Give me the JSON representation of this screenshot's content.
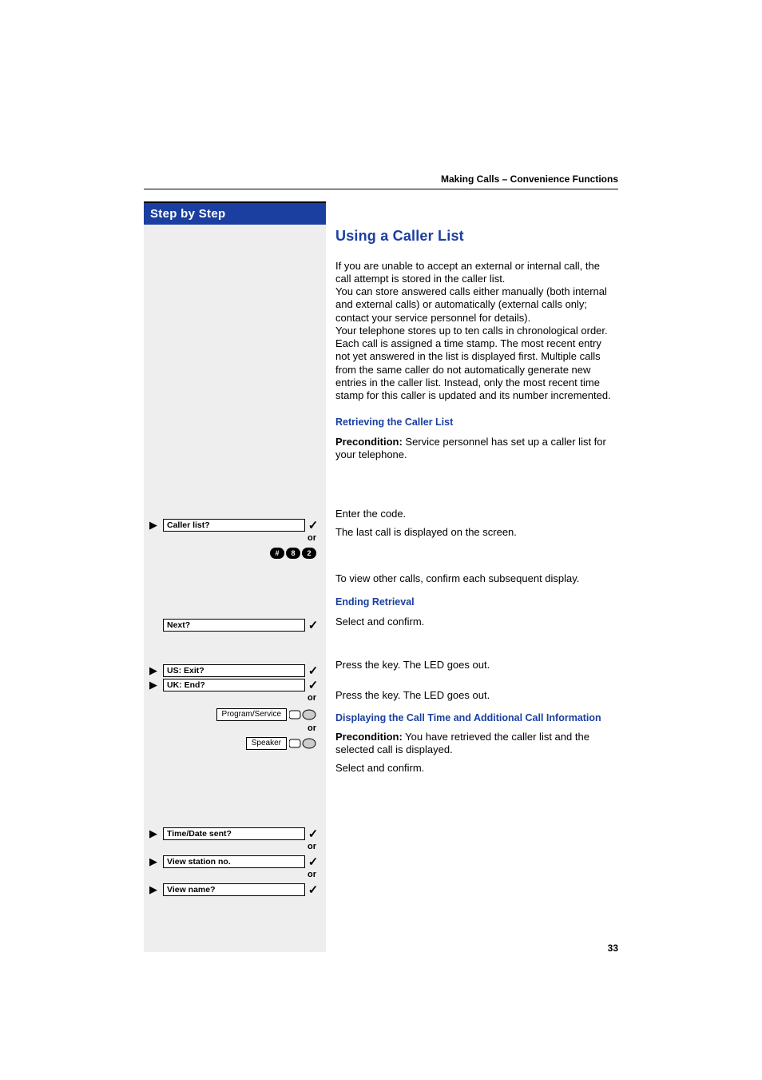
{
  "header": "Making Calls – Convenience Functions",
  "step_header": "Step by Step",
  "page_number": "33",
  "section_title": "Using a Caller List",
  "intro": "If you are unable to accept an external or internal call, the call attempt is stored in the caller list.\nYou can store answered calls either manually (both internal and external calls) or automatically (external calls only; contact your service personnel for details).\nYour telephone stores up to ten calls in chronological order. Each call is assigned a time stamp. The most recent entry not yet answered in the list is displayed first. Multiple calls from the same caller do not automatically generate new entries in the caller list. Instead, only the most recent time stamp for this caller is updated and its number incremented.",
  "retrieving": {
    "title": "Retrieving the Caller List",
    "precond_label": "Precondition:",
    "precond_text": " Service personnel has set up a caller list for your telephone.",
    "enter_code": "Enter the code.",
    "last_call": "The last call is displayed on the screen.",
    "view_other": "To view other calls, confirm each subsequent display."
  },
  "ending": {
    "title": "Ending Retrieval",
    "select_confirm": "Select and confirm.",
    "press_key": "Press the key. The LED goes out."
  },
  "display_info": {
    "title": "Displaying the Call Time and Additional Call Information",
    "precond_label": "Precondition:",
    "precond_text": " You have retrieved the caller list and the selected call is displayed.",
    "select_confirm": "Select and confirm."
  },
  "prompts": {
    "caller_list": "Caller list?",
    "next": "Next?",
    "us_exit": "US: Exit?",
    "uk_end": "UK: End?",
    "program_service": "Program/Service",
    "speaker": "Speaker",
    "time_date": "Time/Date sent?",
    "view_station": "View station no.",
    "view_name": "View name?",
    "or": "or"
  },
  "code_keys": [
    "#",
    "8",
    "2"
  ]
}
